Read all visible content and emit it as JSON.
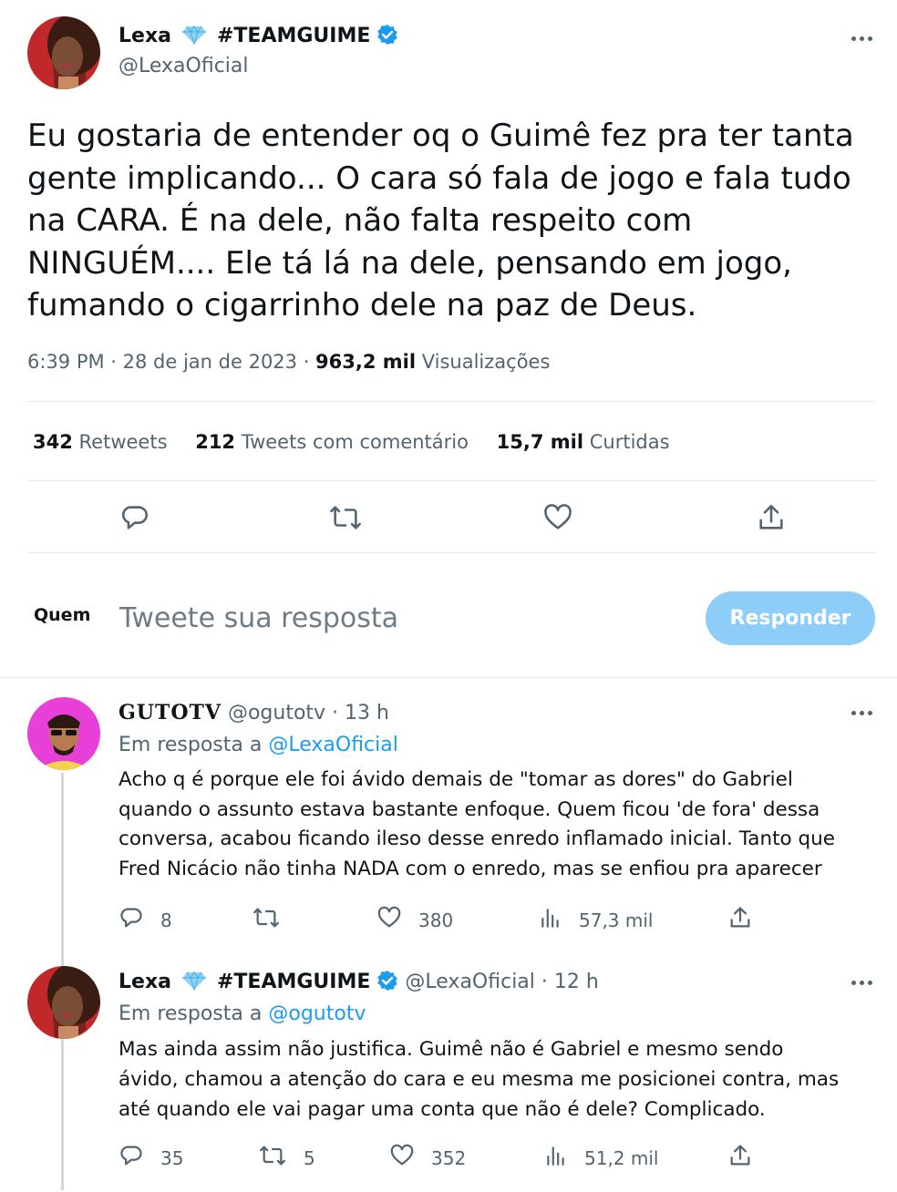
{
  "main_tweet": {
    "author": {
      "name": "Lexa",
      "team": "#TEAMGUIME",
      "handle": "@LexaOficial",
      "avatar_icon": "lexa-avatar-icon"
    },
    "text_lines": [
      "Eu gostaria de entender oq o Guimê fez pra ter tanta",
      "gente implicando... O cara só fala de jogo e fala tudo",
      "na CARA. É na dele, não falta respeito com",
      "NINGUÉM.... Ele tá lá na dele, pensando em jogo,",
      "fumando o cigarrinho dele na paz de Deus."
    ],
    "meta": {
      "time_date": "6:39 PM · 28 de jan de 2023 · ",
      "views_count": "963,2 mil",
      "views_label": " Visualizações"
    },
    "stats": {
      "retweets_count": "342",
      "retweets_label": " Retweets",
      "quotes_count": "212",
      "quotes_label": " Tweets com comentário",
      "likes_count": "15,7 mil",
      "likes_label": " Curtidas"
    }
  },
  "composer": {
    "avatar_text": "Quem",
    "placeholder": "Tweete sua resposta",
    "button_label": "Responder"
  },
  "replies": [
    {
      "name": "GUTOTV",
      "handle": "@ogutotv",
      "time": " · 13 h",
      "reply_to_label": "Em resposta a ",
      "reply_to": "@LexaOficial",
      "text_lines": [
        "Acho q é porque ele foi ávido demais de \"tomar as dores\" do Gabriel",
        "quando o assunto estava bastante enfoque. Quem ficou 'de fora' dessa",
        "conversa, acabou ficando ileso desse enredo inflamado inicial. Tanto que",
        "Fred Nicácio não tinha NADA com o enredo, mas se enfiou pra aparecer"
      ],
      "replies_count": "8",
      "retweets_count": "",
      "likes_count": "380",
      "views_count": "57,3 mil"
    },
    {
      "name": "Lexa",
      "team": "#TEAMGUIME",
      "handle": "@LexaOficial",
      "time": " · 12 h",
      "reply_to_label": "Em resposta a ",
      "reply_to": "@ogutotv",
      "text_lines": [
        "Mas ainda assim não justifica. Guimê não é Gabriel e mesmo sendo",
        "ávido, chamou a atenção do cara e eu mesma me posicionei contra, mas",
        "até quando ele vai pagar uma conta que não é dele? Complicado."
      ],
      "replies_count": "35",
      "retweets_count": "5",
      "likes_count": "352",
      "views_count": "51,2 mil"
    }
  ],
  "colors": {
    "accent": "#1d9bf0",
    "text": "#0f1419",
    "muted": "#536471",
    "button_disabled": "#8ecdf8",
    "gutotv_avatar_bg": "#e83fd9"
  }
}
